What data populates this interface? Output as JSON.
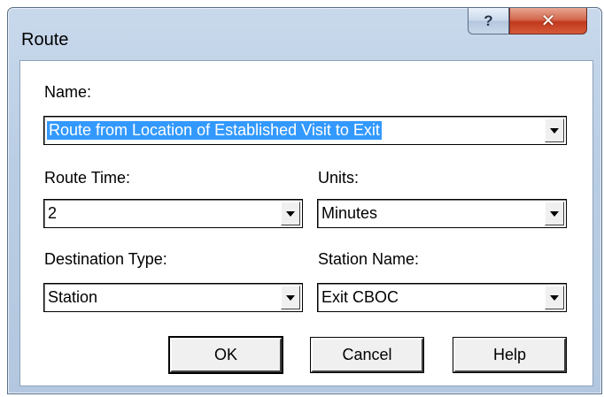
{
  "window": {
    "title": "Route",
    "help_glyph": "?",
    "close_glyph": "✕"
  },
  "form": {
    "name_label": "Name:",
    "name_value": "Route from Location of Established Visit to Exit",
    "route_time_label": "Route Time:",
    "route_time_value": "2",
    "units_label": "Units:",
    "units_value": "Minutes",
    "destination_type_label": "Destination Type:",
    "destination_type_value": "Station",
    "station_name_label": "Station Name:",
    "station_name_value": "Exit CBOC"
  },
  "buttons": {
    "ok": "OK",
    "cancel": "Cancel",
    "help": "Help"
  },
  "icons": {
    "help": "question-icon",
    "close": "close-icon",
    "dropdown": "chevron-down-icon"
  }
}
